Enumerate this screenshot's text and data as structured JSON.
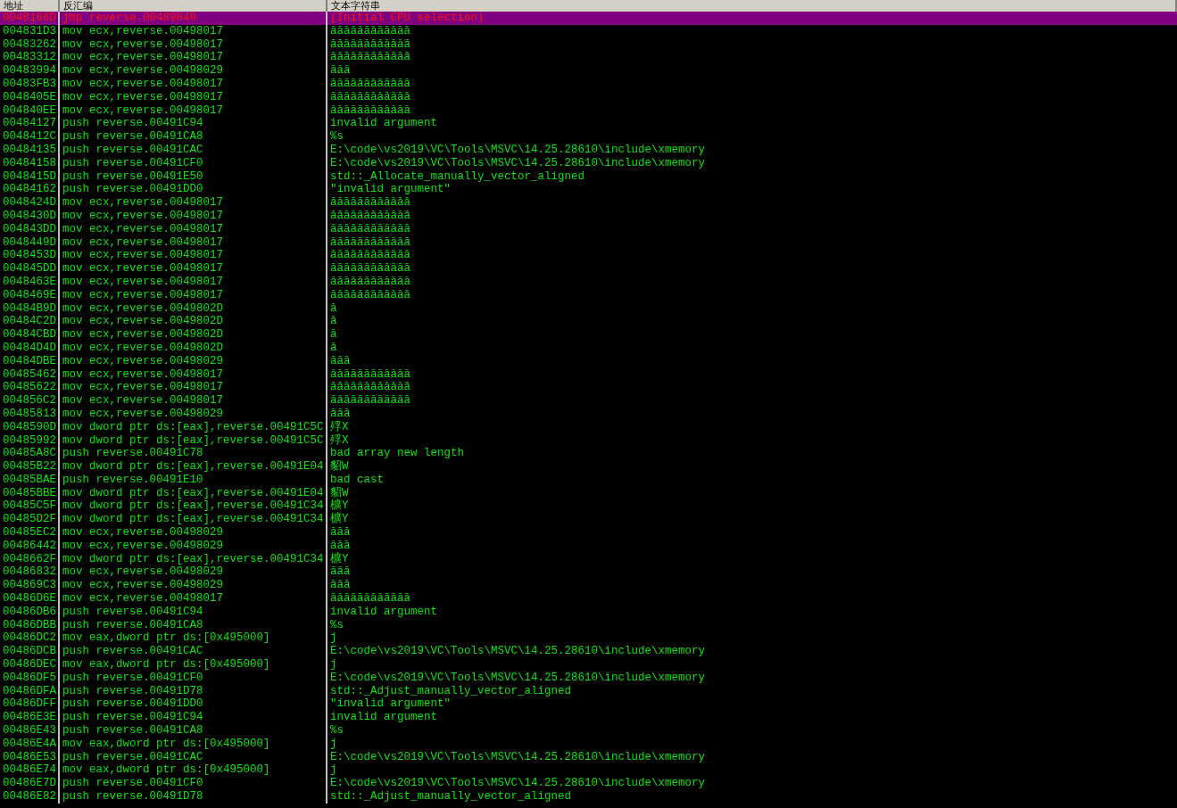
{
  "table": {
    "columns": [
      "地址",
      "反汇编",
      "文本字符串"
    ],
    "rows": [
      {
        "address": "0048166D",
        "disassembly": "jmp reverse.00489840",
        "text": "(Initial CPU selection)",
        "selected": true
      },
      {
        "address": "004831D3",
        "disassembly": "mov ecx,reverse.00498017",
        "text": "āāāāāāāāāāāā",
        "selected": false
      },
      {
        "address": "00483262",
        "disassembly": "mov ecx,reverse.00498017",
        "text": "āāāāāāāāāāāā",
        "selected": false
      },
      {
        "address": "00483312",
        "disassembly": "mov ecx,reverse.00498017",
        "text": "āāāāāāāāāāāā",
        "selected": false
      },
      {
        "address": "00483994",
        "disassembly": "mov ecx,reverse.00498029",
        "text": "āāā",
        "selected": false
      },
      {
        "address": "00483FB3",
        "disassembly": "mov ecx,reverse.00498017",
        "text": "āāāāāāāāāāāā",
        "selected": false
      },
      {
        "address": "0048405E",
        "disassembly": "mov ecx,reverse.00498017",
        "text": "āāāāāāāāāāāā",
        "selected": false
      },
      {
        "address": "004840EE",
        "disassembly": "mov ecx,reverse.00498017",
        "text": "āāāāāāāāāāāā",
        "selected": false
      },
      {
        "address": "00484127",
        "disassembly": "push reverse.00491C94",
        "text": "invalid argument",
        "selected": false
      },
      {
        "address": "0048412C",
        "disassembly": "push reverse.00491CA8",
        "text": "%s",
        "selected": false
      },
      {
        "address": "00484135",
        "disassembly": "push reverse.00491CAC",
        "text": "E:\\code\\vs2019\\VC\\Tools\\MSVC\\14.25.28610\\include\\xmemory",
        "selected": false
      },
      {
        "address": "00484158",
        "disassembly": "push reverse.00491CF0",
        "text": "E:\\code\\vs2019\\VC\\Tools\\MSVC\\14.25.28610\\include\\xmemory",
        "selected": false
      },
      {
        "address": "0048415D",
        "disassembly": "push reverse.00491E50",
        "text": "std::_Allocate_manually_vector_aligned",
        "selected": false
      },
      {
        "address": "00484162",
        "disassembly": "push reverse.00491DD0",
        "text": "\"invalid argument\"",
        "selected": false
      },
      {
        "address": "0048424D",
        "disassembly": "mov ecx,reverse.00498017",
        "text": "āāāāāāāāāāāā",
        "selected": false
      },
      {
        "address": "0048430D",
        "disassembly": "mov ecx,reverse.00498017",
        "text": "āāāāāāāāāāāā",
        "selected": false
      },
      {
        "address": "004843DD",
        "disassembly": "mov ecx,reverse.00498017",
        "text": "āāāāāāāāāāāā",
        "selected": false
      },
      {
        "address": "0048449D",
        "disassembly": "mov ecx,reverse.00498017",
        "text": "āāāāāāāāāāāā",
        "selected": false
      },
      {
        "address": "0048453D",
        "disassembly": "mov ecx,reverse.00498017",
        "text": "āāāāāāāāāāāā",
        "selected": false
      },
      {
        "address": "004845DD",
        "disassembly": "mov ecx,reverse.00498017",
        "text": "āāāāāāāāāāāā",
        "selected": false
      },
      {
        "address": "0048463E",
        "disassembly": "mov ecx,reverse.00498017",
        "text": "āāāāāāāāāāāā",
        "selected": false
      },
      {
        "address": "0048469E",
        "disassembly": "mov ecx,reverse.00498017",
        "text": "āāāāāāāāāāāā",
        "selected": false
      },
      {
        "address": "00484B9D",
        "disassembly": "mov ecx,reverse.0049802D",
        "text": "ā",
        "selected": false
      },
      {
        "address": "00484C2D",
        "disassembly": "mov ecx,reverse.0049802D",
        "text": "ā",
        "selected": false
      },
      {
        "address": "00484CBD",
        "disassembly": "mov ecx,reverse.0049802D",
        "text": "ā",
        "selected": false
      },
      {
        "address": "00484D4D",
        "disassembly": "mov ecx,reverse.0049802D",
        "text": "ā",
        "selected": false
      },
      {
        "address": "00484DBE",
        "disassembly": "mov ecx,reverse.00498029",
        "text": "āāā",
        "selected": false
      },
      {
        "address": "00485462",
        "disassembly": "mov ecx,reverse.00498017",
        "text": "āāāāāāāāāāāā",
        "selected": false
      },
      {
        "address": "00485622",
        "disassembly": "mov ecx,reverse.00498017",
        "text": "āāāāāāāāāāāā",
        "selected": false
      },
      {
        "address": "004856C2",
        "disassembly": "mov ecx,reverse.00498017",
        "text": "āāāāāāāāāāāā",
        "selected": false
      },
      {
        "address": "00485813",
        "disassembly": "mov ecx,reverse.00498029",
        "text": "āāā",
        "selected": false
      },
      {
        "address": "0048590D",
        "disassembly": "mov dword ptr ds:[eax],reverse.00491C5C",
        "text": "殍X",
        "selected": false
      },
      {
        "address": "00485992",
        "disassembly": "mov dword ptr ds:[eax],reverse.00491C5C",
        "text": "殍X",
        "selected": false
      },
      {
        "address": "00485A8C",
        "disassembly": "push reverse.00491C78",
        "text": "bad array new length",
        "selected": false
      },
      {
        "address": "00485B22",
        "disassembly": "mov dword ptr ds:[eax],reverse.00491E04",
        "text": "貂W",
        "selected": false
      },
      {
        "address": "00485BAE",
        "disassembly": "push reverse.00491E10",
        "text": "bad cast",
        "selected": false
      },
      {
        "address": "00485BBE",
        "disassembly": "mov dword ptr ds:[eax],reverse.00491E04",
        "text": "貂W",
        "selected": false
      },
      {
        "address": "00485C5F",
        "disassembly": "mov dword ptr ds:[eax],reverse.00491C34",
        "text": "櫎Y",
        "selected": false
      },
      {
        "address": "00485D2F",
        "disassembly": "mov dword ptr ds:[eax],reverse.00491C34",
        "text": "櫎Y",
        "selected": false
      },
      {
        "address": "00485EC2",
        "disassembly": "mov ecx,reverse.00498029",
        "text": "āāā",
        "selected": false
      },
      {
        "address": "00486442",
        "disassembly": "mov ecx,reverse.00498029",
        "text": "āāā",
        "selected": false
      },
      {
        "address": "0048662F",
        "disassembly": "mov dword ptr ds:[eax],reverse.00491C34",
        "text": "櫎Y",
        "selected": false
      },
      {
        "address": "00486832",
        "disassembly": "mov ecx,reverse.00498029",
        "text": "āāā",
        "selected": false
      },
      {
        "address": "004869C3",
        "disassembly": "mov ecx,reverse.00498029",
        "text": "āāā",
        "selected": false
      },
      {
        "address": "00486D6E",
        "disassembly": "mov ecx,reverse.00498017",
        "text": "āāāāāāāāāāāā",
        "selected": false
      },
      {
        "address": "00486DB6",
        "disassembly": "push reverse.00491C94",
        "text": "invalid argument",
        "selected": false
      },
      {
        "address": "00486DBB",
        "disassembly": "push reverse.00491CA8",
        "text": "%s",
        "selected": false
      },
      {
        "address": "00486DC2",
        "disassembly": "mov eax,dword ptr ds:[0x495000]",
        "text": "j",
        "selected": false
      },
      {
        "address": "00486DCB",
        "disassembly": "push reverse.00491CAC",
        "text": "E:\\code\\vs2019\\VC\\Tools\\MSVC\\14.25.28610\\include\\xmemory",
        "selected": false
      },
      {
        "address": "00486DEC",
        "disassembly": "mov eax,dword ptr ds:[0x495000]",
        "text": "j",
        "selected": false
      },
      {
        "address": "00486DF5",
        "disassembly": "push reverse.00491CF0",
        "text": "E:\\code\\vs2019\\VC\\Tools\\MSVC\\14.25.28610\\include\\xmemory",
        "selected": false
      },
      {
        "address": "00486DFA",
        "disassembly": "push reverse.00491D78",
        "text": "std::_Adjust_manually_vector_aligned",
        "selected": false
      },
      {
        "address": "00486DFF",
        "disassembly": "push reverse.00491DD0",
        "text": "\"invalid argument\"",
        "selected": false
      },
      {
        "address": "00486E3E",
        "disassembly": "push reverse.00491C94",
        "text": "invalid argument",
        "selected": false
      },
      {
        "address": "00486E43",
        "disassembly": "push reverse.00491CA8",
        "text": "%s",
        "selected": false
      },
      {
        "address": "00486E4A",
        "disassembly": "mov eax,dword ptr ds:[0x495000]",
        "text": "j",
        "selected": false
      },
      {
        "address": "00486E53",
        "disassembly": "push reverse.00491CAC",
        "text": "E:\\code\\vs2019\\VC\\Tools\\MSVC\\14.25.28610\\include\\xmemory",
        "selected": false
      },
      {
        "address": "00486E74",
        "disassembly": "mov eax,dword ptr ds:[0x495000]",
        "text": "j",
        "selected": false
      },
      {
        "address": "00486E7D",
        "disassembly": "push reverse.00491CF0",
        "text": "E:\\code\\vs2019\\VC\\Tools\\MSVC\\14.25.28610\\include\\xmemory",
        "selected": false
      },
      {
        "address": "00486E82",
        "disassembly": "push reverse.00491D78",
        "text": "std::_Adjust_manually_vector_aligned",
        "selected": false
      }
    ]
  }
}
